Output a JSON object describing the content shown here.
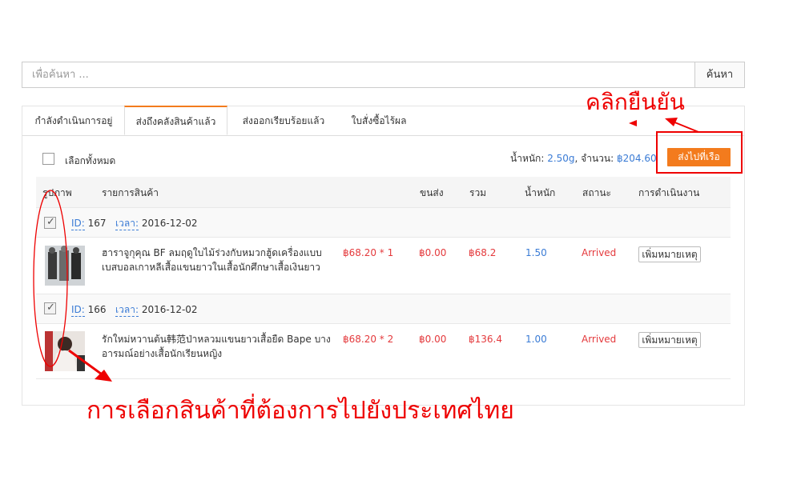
{
  "search": {
    "placeholder": "เพื่อค้นหา ...",
    "button_label": "ค้นหา"
  },
  "tabs": [
    {
      "label": "กำลังดำเนินการอยู่",
      "active": false
    },
    {
      "label": "ส่งถึงคลังสินค้าแล้ว",
      "active": true
    },
    {
      "label": "ส่งออกเรียบร้อยแล้ว",
      "active": false
    },
    {
      "label": "ใบสั่งซื้อไร้ผล",
      "active": false
    }
  ],
  "toolbar": {
    "select_all_label": "เลือกทั้งหมด",
    "weight_label": "น้ำหนัก:",
    "weight_value": "2.50g",
    "count_label": ", จำนวน:",
    "count_value": "฿204.60",
    "ship_button_label": "ส่งไปที่เรือ"
  },
  "table": {
    "headers": [
      "รูปภาพ",
      "รายการสินค้า",
      "ขนส่ง",
      "รวม",
      "น้ำหนัก",
      "สถานะ",
      "การดำเนินงาน"
    ],
    "groups": [
      {
        "checked": true,
        "id_label": "ID:",
        "id_value": "167",
        "time_label": "เวลา:",
        "time_value": "2016-12-02",
        "item": {
          "title_line1": "ฮาราจูกุคุณ BF ลมฤดูใบไม้ร่วงกับหมวกฮู้ดเครื่องแบบ",
          "title_line2": "เบสบอลเกาหลีเสื้อแขนยาวในเสื้อนักศึกษาเสื้อเงินยาว",
          "price": "฿68.20 * 1",
          "shipping": "฿0.00",
          "total": "฿68.2",
          "weight": "1.50",
          "status": "Arrived",
          "action_label": "เพิ่มหมายเหตุ"
        }
      },
      {
        "checked": true,
        "id_label": "ID:",
        "id_value": "166",
        "time_label": "เวลา:",
        "time_value": "2016-12-02",
        "item": {
          "title_line1": "รักใหม่หวานต้น韩范ป่าหลวมแขนยาวเสื้อยืด Bape บาง",
          "title_line2": "อารมณ์อย่างเสื้อนักเรียนหญิง",
          "price": "฿68.20 * 2",
          "shipping": "฿0.00",
          "total": "฿136.4",
          "weight": "1.00",
          "status": "Arrived",
          "action_label": "เพิ่มหมายเหตุ"
        }
      }
    ]
  },
  "annotations": {
    "confirm_click": "คลิกยืนยัน",
    "select_products": "การเลือกสินค้าที่ต้องการไปยังประเทศไทย",
    "color": "#ee0000"
  },
  "colors": {
    "accent": "#f37b1d",
    "link": "#3a7bd5",
    "status": "#e4393c"
  }
}
